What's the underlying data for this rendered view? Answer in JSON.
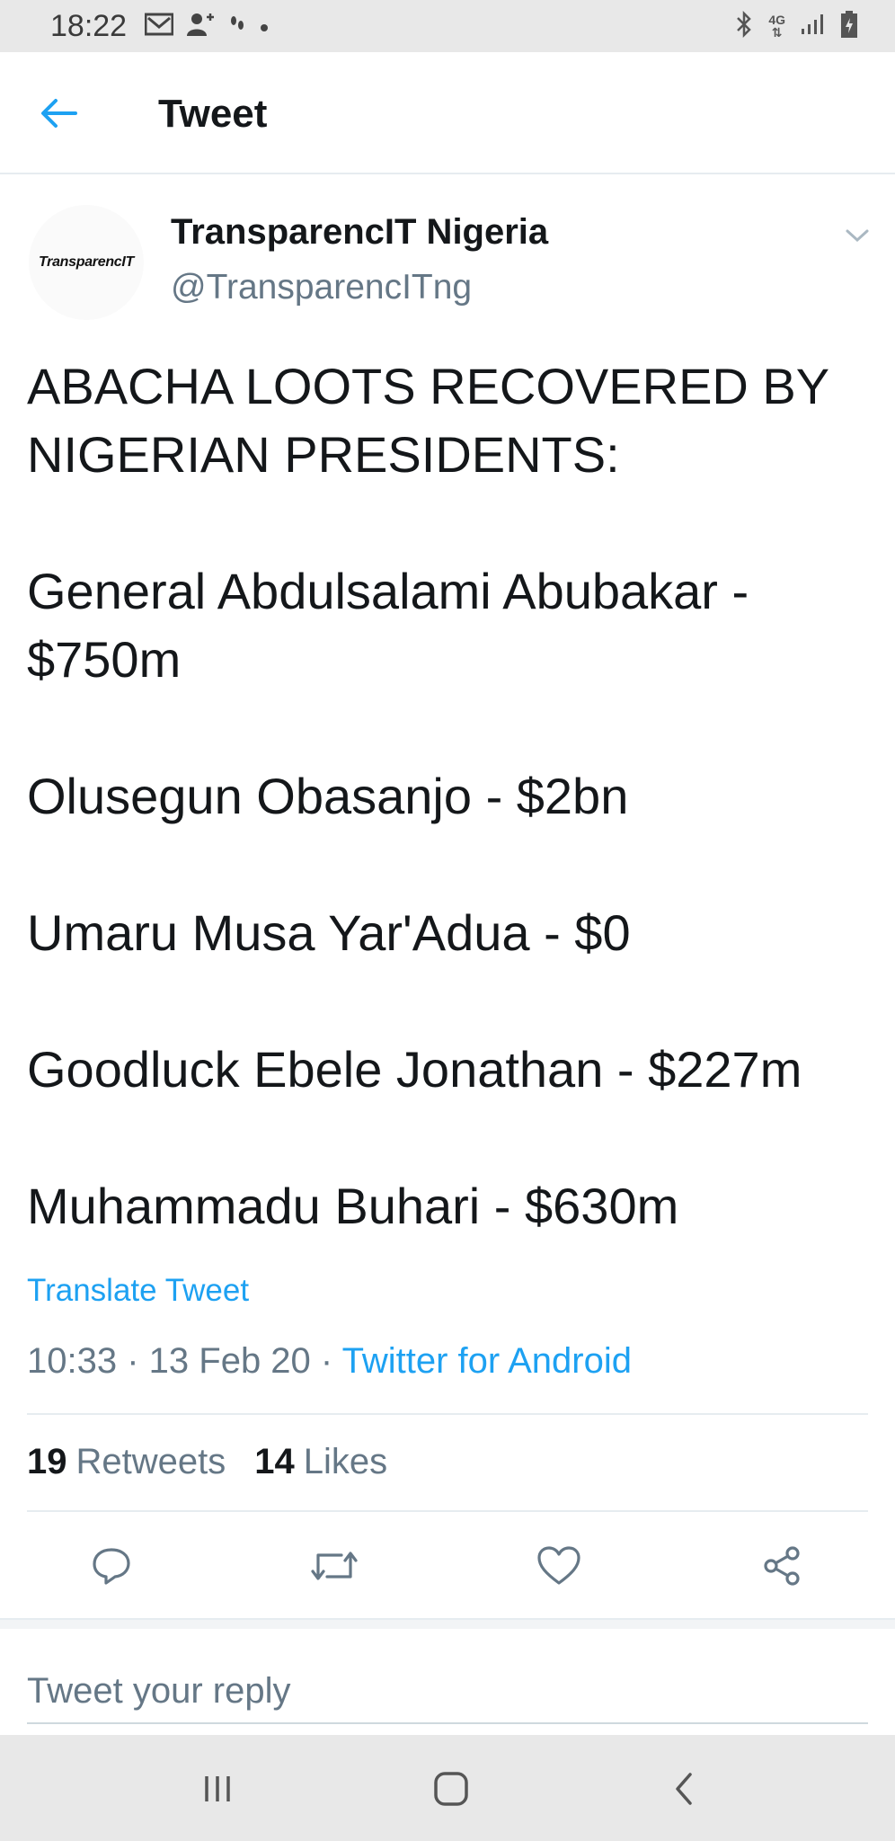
{
  "status_bar": {
    "time": "18:22",
    "network": "4G"
  },
  "header": {
    "title": "Tweet"
  },
  "author": {
    "avatar_text": "TransparencIT",
    "name": "TransparencIT Nigeria",
    "handle": "@TransparencITng"
  },
  "tweet": {
    "lines": [
      "ABACHA LOOTS RECOVERED BY",
      "NIGERIAN PRESIDENTS:",
      "",
      "General Abdulsalami Abubakar -",
      "$750m",
      "",
      "Olusegun Obasanjo - $2bn",
      "",
      "Umaru Musa Yar'Adua - $0",
      "",
      "Goodluck Ebele Jonathan - $227m",
      "",
      "Muhammadu Buhari - $630m"
    ],
    "translate_label": "Translate Tweet",
    "time": "10:33",
    "date": "13 Feb 20",
    "separator": " · ",
    "source": "Twitter for Android"
  },
  "stats": {
    "retweets_count": "19",
    "retweets_label": "Retweets",
    "likes_count": "14",
    "likes_label": "Likes"
  },
  "actions": [
    "reply-icon",
    "retweet-icon",
    "like-icon",
    "share-icon"
  ],
  "reply": {
    "placeholder": "Tweet your reply"
  },
  "colors": {
    "accent": "#1da1f2",
    "secondary_text": "#657786",
    "text": "#14171a"
  }
}
